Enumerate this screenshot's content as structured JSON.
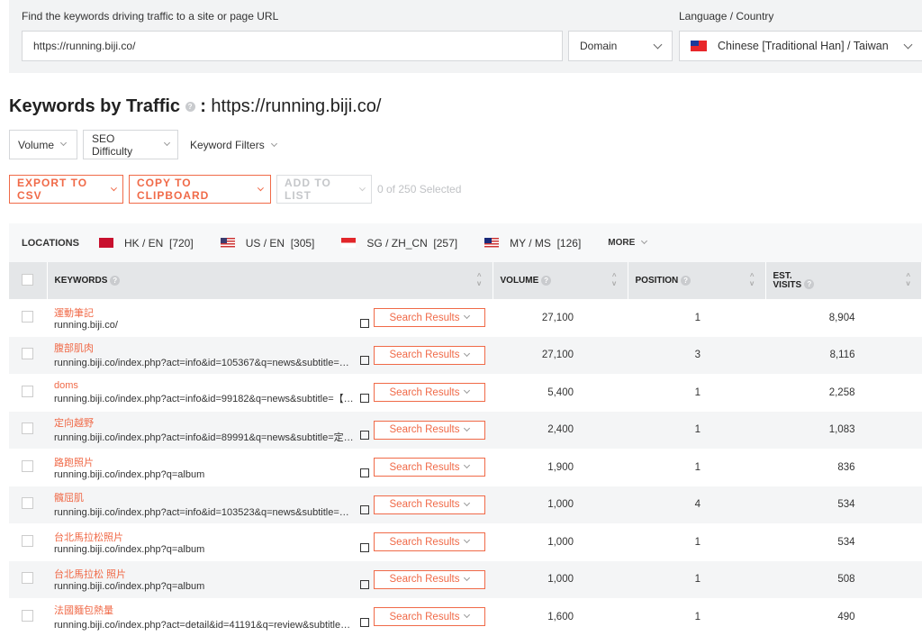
{
  "search": {
    "label": "Find the keywords driving traffic to a site or page URL",
    "value": "https://running.biji.co/",
    "scope": "Domain",
    "lang_label": "Language / Country",
    "lang": "Chinese [Traditional Han] / Taiwan"
  },
  "title": {
    "main": "Keywords by Traffic",
    "sep": ":",
    "url": "https://running.biji.co/"
  },
  "filters": [
    "Volume",
    "SEO Difficulty",
    "Keyword Filters"
  ],
  "actions": {
    "export": "EXPORT TO CSV",
    "copy": "COPY TO CLIPBOARD",
    "add": "ADD TO LIST",
    "selected": "0 of 250 Selected"
  },
  "locations": {
    "label": "LOCATIONS",
    "items": [
      {
        "label": "HK / EN",
        "count": "[720]"
      },
      {
        "label": "US / EN",
        "count": "[305]"
      },
      {
        "label": "SG / ZH_CN",
        "count": "[257]"
      },
      {
        "label": "MY / MS",
        "count": "[126]"
      }
    ],
    "more": "MORE"
  },
  "table": {
    "headers": [
      "KEYWORDS",
      "VOLUME",
      "POSITION",
      "EST. VISITS"
    ],
    "button": "Search Results",
    "rows": [
      {
        "kw": "運動筆記",
        "url": "running.biji.co/",
        "volume": "27,100",
        "position": "1",
        "visits": "8,904"
      },
      {
        "kw": "腹部肌肉",
        "url": "running.biji.co/index.php?act=info&id=105367&q=news&subtitle=【訓練】...",
        "volume": "27,100",
        "position": "3",
        "visits": "8,116"
      },
      {
        "kw": "doms",
        "url": "running.biji.co/index.php?act=info&id=99182&q=news&subtitle=【迷思】遲...",
        "volume": "5,400",
        "position": "1",
        "visits": "2,258"
      },
      {
        "kw": "定向越野",
        "url": "running.biji.co/index.php?act=info&id=89991&q=news&subtitle=定向越野怎...",
        "volume": "2,400",
        "position": "1",
        "visits": "1,083"
      },
      {
        "kw": "路跑照片",
        "url": "running.biji.co/index.php?q=album",
        "volume": "1,900",
        "position": "1",
        "visits": "836"
      },
      {
        "kw": "髖屈肌",
        "url": "running.biji.co/index.php?act=info&id=103523&q=news&subtitle=【知識】...",
        "volume": "1,000",
        "position": "4",
        "visits": "534"
      },
      {
        "kw": "台北馬拉松照片",
        "url": "running.biji.co/index.php?q=album",
        "volume": "1,000",
        "position": "1",
        "visits": "534"
      },
      {
        "kw": "台北馬拉松 照片",
        "url": "running.biji.co/index.php?q=album",
        "volume": "1,000",
        "position": "1",
        "visits": "508"
      },
      {
        "kw": "法國麵包熱量",
        "url": "running.biji.co/index.php?act=detail&id=41191&q=review&subtitle=【最不健...",
        "volume": "1,600",
        "position": "1",
        "visits": "490"
      }
    ]
  },
  "colors": {
    "accent": "#f06a48"
  }
}
